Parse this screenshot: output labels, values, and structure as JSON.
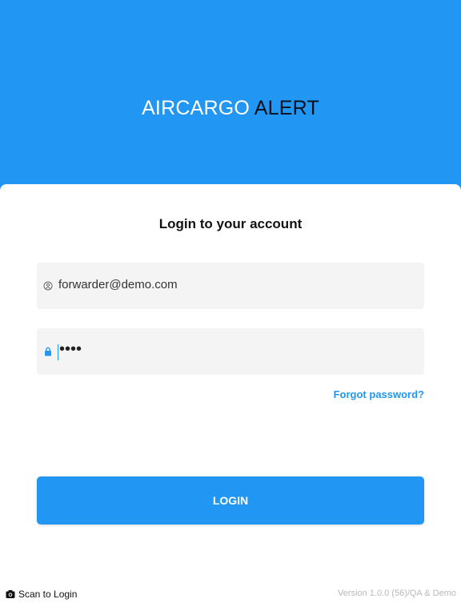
{
  "brand": {
    "part1": "AIRCARGO",
    "part2": "ALERT"
  },
  "login": {
    "title": "Login to your account",
    "email_value": "forwarder@demo.com",
    "email_icon": "user-circle-icon",
    "password_mask": "••••",
    "password_icon": "lock-icon",
    "forgot_label": "Forgot password?",
    "submit_label": "LOGIN"
  },
  "footer": {
    "scan_label": "Scan to Login",
    "scan_icon": "camera-icon",
    "version": "Version 1.0.0 (56)/QA & Demo"
  },
  "colors": {
    "accent": "#2196f3",
    "brand_dark": "#0a0f1a",
    "field_bg": "#f4f4f4"
  }
}
